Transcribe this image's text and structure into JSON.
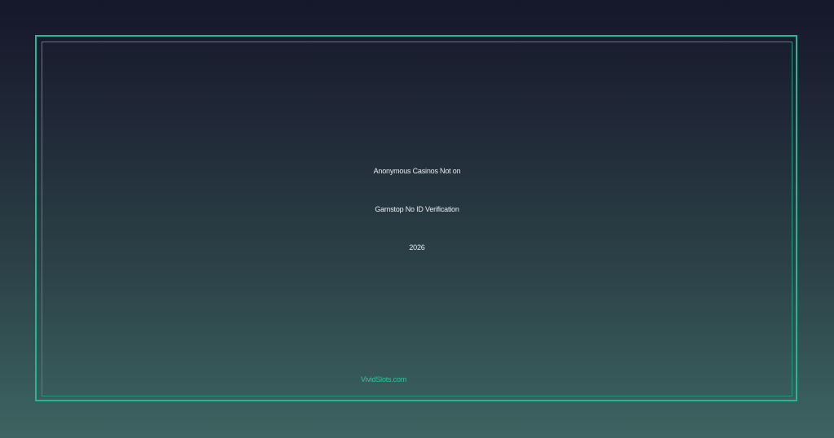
{
  "headline": {
    "line1": "Anonymous Casinos Not on",
    "line2": "Gamstop No ID Verification",
    "line3": "2026"
  },
  "brand": {
    "name": "VividSlots.com"
  },
  "colors": {
    "accent": "#21b994",
    "brand_text": "#2bc79a",
    "text": "#e9edf0",
    "background_top": "#15172a",
    "background_bottom": "#3d6462"
  }
}
